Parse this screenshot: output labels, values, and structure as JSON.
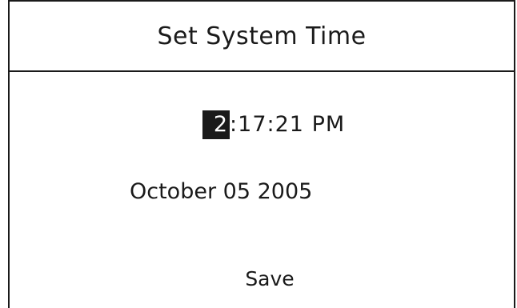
{
  "dialog": {
    "title": "Set System Time"
  },
  "time": {
    "hour": "2",
    "sep1": ":",
    "minute": "17",
    "sep2": ":",
    "second": "21",
    "ampm": "PM",
    "selected_field": "hour"
  },
  "date": {
    "month": "October",
    "day": "05",
    "year": "2005"
  },
  "actions": {
    "save_label": "Save"
  },
  "colors": {
    "foreground": "#1a1a1a",
    "background": "#ffffff",
    "selection_bg": "#1a1a1a",
    "selection_fg": "#ffffff"
  }
}
